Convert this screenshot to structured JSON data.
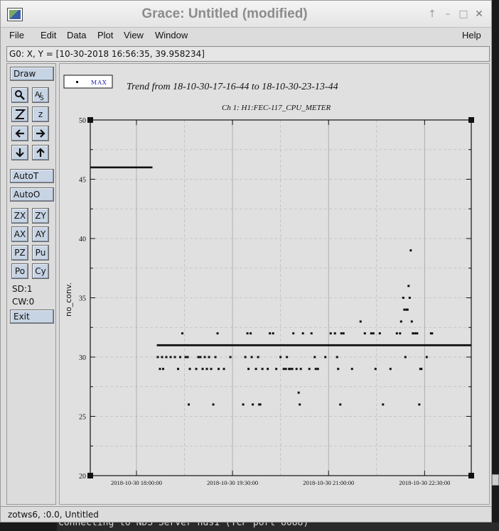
{
  "window": {
    "title": "Grace: Untitled (modified)",
    "controls": {
      "up": "↑",
      "minimize": "–",
      "maximize": "□",
      "close": "✕"
    }
  },
  "menubar": {
    "items": [
      "File",
      "Edit",
      "Data",
      "Plot",
      "View",
      "Window"
    ],
    "help": "Help"
  },
  "locator": "G0: X, Y = [10-30-2018 16:56:35, 39.958234]",
  "toolbar": {
    "draw": "Draw",
    "autot": "AutoT",
    "autoo": "AutoO",
    "zx": "ZX",
    "zy": "ZY",
    "ax": "AX",
    "ay": "AY",
    "pz": "PZ",
    "pu": "Pu",
    "po": "Po",
    "cy": "Cy",
    "sd": "SD:1",
    "cw": "CW:0",
    "exit": "Exit",
    "z_small": "z"
  },
  "status": "zotws6, :0.0, Untitled",
  "terminal": "Connecting to NDS Server nds1 (TCP port 8088)",
  "chart_data": {
    "type": "scatter",
    "title": "Trend from 18-10-30-17-16-44 to 18-10-30-23-13-44",
    "subtitle": "Ch 1: H1:FEC-117_CPU_METER",
    "legend": [
      "MAX"
    ],
    "legend_position": "top-left",
    "ylabel": "no_conv.",
    "ylim": [
      20,
      50
    ],
    "yticks": [
      20,
      25,
      30,
      35,
      40,
      45,
      50
    ],
    "xlim": [
      "2018-10-30 17:16:44",
      "2018-10-30 23:13:44"
    ],
    "xticks": [
      "2018-10-30 18:00:00",
      "2018-10-30 19:30:00",
      "2018-10-30 21:00:00",
      "2018-10-30 22:30:00"
    ],
    "grid": true,
    "series": [
      {
        "name": "MAX",
        "segments": [
          {
            "x0": "2018-10-30 17:16:44",
            "x1": "2018-10-30 18:15:00",
            "y": 46
          }
        ],
        "baseline": {
          "x0": "2018-10-30 18:20:00",
          "x1": "2018-10-30 23:13:44",
          "y": 31
        },
        "points": [
          [
            "2018-10-30 18:20",
            30
          ],
          [
            "2018-10-30 18:22",
            29
          ],
          [
            "2018-10-30 18:24",
            30
          ],
          [
            "2018-10-30 18:25",
            29
          ],
          [
            "2018-10-30 18:28",
            30
          ],
          [
            "2018-10-30 18:32",
            30
          ],
          [
            "2018-10-30 18:36",
            30
          ],
          [
            "2018-10-30 18:39",
            29
          ],
          [
            "2018-10-30 18:41",
            30
          ],
          [
            "2018-10-30 18:43",
            32
          ],
          [
            "2018-10-30 18:46",
            30
          ],
          [
            "2018-10-30 18:48",
            30
          ],
          [
            "2018-10-30 18:49",
            26
          ],
          [
            "2018-10-30 18:50",
            29
          ],
          [
            "2018-10-30 18:56",
            29
          ],
          [
            "2018-10-30 18:58",
            30
          ],
          [
            "2018-10-30 19:00",
            30
          ],
          [
            "2018-10-30 19:02",
            29
          ],
          [
            "2018-10-30 19:04",
            30
          ],
          [
            "2018-10-30 19:06",
            29
          ],
          [
            "2018-10-30 19:08",
            30
          ],
          [
            "2018-10-30 19:10",
            29
          ],
          [
            "2018-10-30 19:12",
            26
          ],
          [
            "2018-10-30 19:14",
            30
          ],
          [
            "2018-10-30 19:16",
            32
          ],
          [
            "2018-10-30 19:17",
            29
          ],
          [
            "2018-10-30 19:22",
            29
          ],
          [
            "2018-10-30 19:28",
            30
          ],
          [
            "2018-10-30 19:40",
            26
          ],
          [
            "2018-10-30 19:42",
            30
          ],
          [
            "2018-10-30 19:44",
            32
          ],
          [
            "2018-10-30 19:45",
            29
          ],
          [
            "2018-10-30 19:47",
            32
          ],
          [
            "2018-10-30 19:48",
            30
          ],
          [
            "2018-10-30 19:49",
            26
          ],
          [
            "2018-10-30 19:52",
            29
          ],
          [
            "2018-10-30 19:54",
            30
          ],
          [
            "2018-10-30 19:55",
            26
          ],
          [
            "2018-10-30 19:56",
            26
          ],
          [
            "2018-10-30 19:58",
            29
          ],
          [
            "2018-10-30 20:03",
            29
          ],
          [
            "2018-10-30 20:05",
            32
          ],
          [
            "2018-10-30 20:08",
            32
          ],
          [
            "2018-10-30 20:11",
            29
          ],
          [
            "2018-10-30 20:15",
            30
          ],
          [
            "2018-10-30 20:18",
            29
          ],
          [
            "2018-10-30 20:20",
            29
          ],
          [
            "2018-10-30 20:21",
            30
          ],
          [
            "2018-10-30 20:23",
            29
          ],
          [
            "2018-10-30 20:24",
            29
          ],
          [
            "2018-10-30 20:26",
            29
          ],
          [
            "2018-10-30 20:27",
            32
          ],
          [
            "2018-10-30 20:30",
            29
          ],
          [
            "2018-10-30 20:32",
            27
          ],
          [
            "2018-10-30 20:33",
            26
          ],
          [
            "2018-10-30 20:34",
            29
          ],
          [
            "2018-10-30 20:36",
            32
          ],
          [
            "2018-10-30 20:42",
            29
          ],
          [
            "2018-10-30 20:44",
            32
          ],
          [
            "2018-10-30 20:47",
            30
          ],
          [
            "2018-10-30 20:48",
            29
          ],
          [
            "2018-10-30 20:50",
            29
          ],
          [
            "2018-10-30 20:57",
            30
          ],
          [
            "2018-10-30 21:02",
            32
          ],
          [
            "2018-10-30 21:06",
            32
          ],
          [
            "2018-10-30 21:08",
            30
          ],
          [
            "2018-10-30 21:09",
            29
          ],
          [
            "2018-10-30 21:11",
            26
          ],
          [
            "2018-10-30 21:12",
            32
          ],
          [
            "2018-10-30 21:14",
            32
          ],
          [
            "2018-10-30 21:22",
            29
          ],
          [
            "2018-10-30 21:30",
            33
          ],
          [
            "2018-10-30 21:34",
            32
          ],
          [
            "2018-10-30 21:40",
            32
          ],
          [
            "2018-10-30 21:42",
            32
          ],
          [
            "2018-10-30 21:44",
            29
          ],
          [
            "2018-10-30 21:48",
            32
          ],
          [
            "2018-10-30 21:51",
            26
          ],
          [
            "2018-10-30 21:58",
            29
          ],
          [
            "2018-10-30 22:04",
            32
          ],
          [
            "2018-10-30 22:07",
            32
          ],
          [
            "2018-10-30 22:08",
            33
          ],
          [
            "2018-10-30 22:10",
            35
          ],
          [
            "2018-10-30 22:11",
            34
          ],
          [
            "2018-10-30 22:12",
            30
          ],
          [
            "2018-10-30 22:13",
            34
          ],
          [
            "2018-10-30 22:14",
            34
          ],
          [
            "2018-10-30 22:15",
            36
          ],
          [
            "2018-10-30 22:16",
            35
          ],
          [
            "2018-10-30 22:17",
            39
          ],
          [
            "2018-10-30 22:18",
            33
          ],
          [
            "2018-10-30 22:19",
            32
          ],
          [
            "2018-10-30 22:21",
            32
          ],
          [
            "2018-10-30 22:23",
            32
          ],
          [
            "2018-10-30 22:25",
            26
          ],
          [
            "2018-10-30 22:26",
            29
          ],
          [
            "2018-10-30 22:27",
            29
          ],
          [
            "2018-10-30 22:32",
            30
          ],
          [
            "2018-10-30 22:36",
            32
          ],
          [
            "2018-10-30 22:37",
            32
          ]
        ]
      }
    ]
  }
}
